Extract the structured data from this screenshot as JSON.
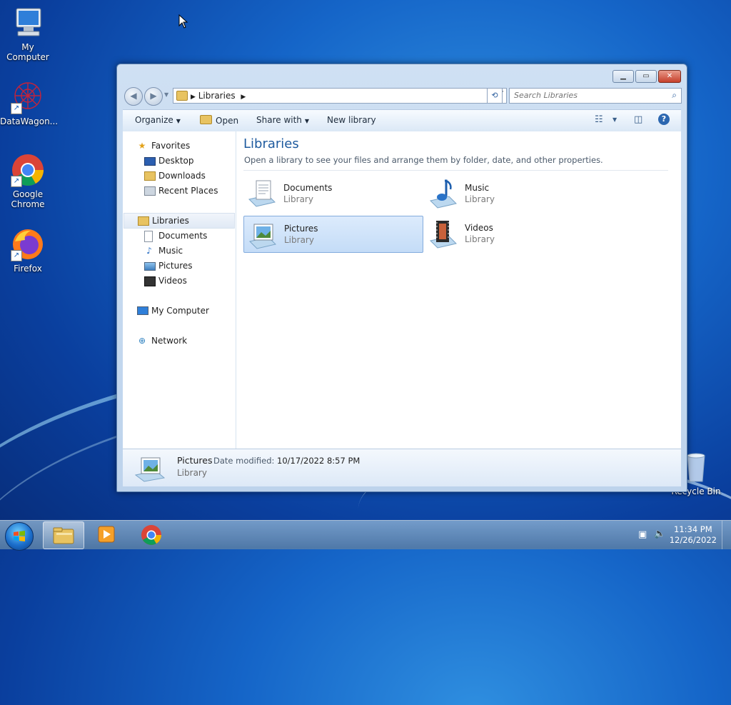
{
  "desktop": {
    "icons": [
      {
        "label": "My Computer"
      },
      {
        "label": "DataWagon..."
      },
      {
        "label": "Google Chrome"
      },
      {
        "label": "Firefox"
      },
      {
        "label": "Recycle Bin"
      }
    ]
  },
  "window": {
    "address": {
      "crumb": "Libraries"
    },
    "search": {
      "placeholder": "Search Libraries"
    },
    "toolbar": {
      "organize": "Organize",
      "open": "Open",
      "share_with": "Share with",
      "new_library": "New library"
    },
    "nav": {
      "favorites": "Favorites",
      "desktop": "Desktop",
      "downloads": "Downloads",
      "recent_places": "Recent Places",
      "libraries": "Libraries",
      "documents": "Documents",
      "music": "Music",
      "pictures": "Pictures",
      "videos": "Videos",
      "my_computer": "My Computer",
      "network": "Network"
    },
    "main": {
      "title": "Libraries",
      "description": "Open a library to see your files and arrange them by folder, date, and other properties.",
      "items": [
        {
          "name": "Documents",
          "type": "Library"
        },
        {
          "name": "Music",
          "type": "Library"
        },
        {
          "name": "Pictures",
          "type": "Library"
        },
        {
          "name": "Videos",
          "type": "Library"
        }
      ]
    },
    "details": {
      "name": "Pictures",
      "modified_label": "Date modified:",
      "modified_value": "10/17/2022 8:57 PM",
      "type": "Library"
    }
  },
  "taskbar": {
    "time": "11:34 PM",
    "date": "12/26/2022"
  }
}
